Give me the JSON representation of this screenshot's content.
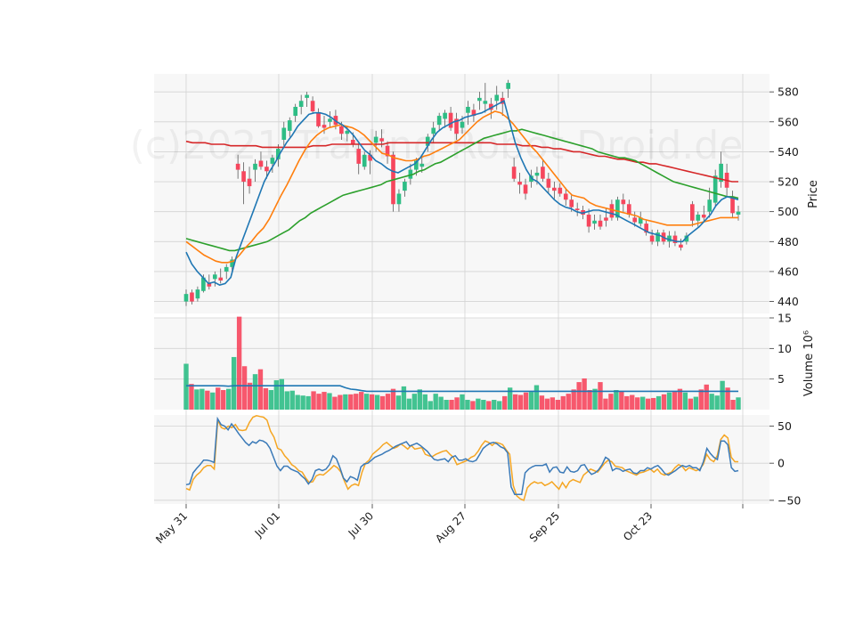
{
  "chart_data": {
    "type": "candlestick",
    "watermark": "(c)2021 Trading Robot Droid.de",
    "colors": {
      "up": "#2ebd85",
      "down": "#f6465d",
      "grid": "#d3d3d3",
      "panel_bg": "#f7f7f7",
      "ma1": "#1f77b4",
      "ma2": "#ff7f0e",
      "ma3": "#2ca02c",
      "ma4": "#d62728",
      "osc1": "#3b7ab8",
      "osc2": "#f5a623",
      "vol_ma": "#1f77b4"
    },
    "x_ticks": [
      "May 31",
      "Jul 01",
      "Jul 30",
      "Aug 27",
      "Sep 25",
      "Oct 23"
    ],
    "price_panel": {
      "ylabel": "Price",
      "ylim": [
        432,
        592
      ],
      "yticks": [
        440,
        460,
        480,
        500,
        520,
        540,
        560,
        580
      ]
    },
    "volume_panel": {
      "ylabel": "Volume  10⁶",
      "ylim": [
        0,
        15
      ],
      "yticks": [
        5,
        10,
        15
      ]
    },
    "osc_panel": {
      "ylim": [
        -55,
        65
      ],
      "yticks": [
        50,
        0,
        -50
      ]
    },
    "ohlc": [
      [
        440,
        448,
        437,
        445
      ],
      [
        446,
        448,
        438,
        440
      ],
      [
        442,
        450,
        440,
        448
      ],
      [
        447,
        458,
        446,
        456
      ],
      [
        452,
        458,
        448,
        450
      ],
      [
        455,
        460,
        450,
        458
      ],
      [
        456,
        462,
        452,
        454
      ],
      [
        460,
        465,
        455,
        463
      ],
      [
        463,
        470,
        458,
        468
      ],
      [
        532,
        538,
        522,
        528
      ],
      [
        527,
        533,
        505,
        520
      ],
      [
        522,
        530,
        512,
        517
      ],
      [
        528,
        535,
        520,
        532
      ],
      [
        534,
        540,
        528,
        530
      ],
      [
        530,
        534,
        522,
        527
      ],
      [
        532,
        538,
        526,
        536
      ],
      [
        535,
        545,
        530,
        542
      ],
      [
        548,
        560,
        544,
        556
      ],
      [
        554,
        563,
        550,
        561
      ],
      [
        564,
        572,
        560,
        570
      ],
      [
        570,
        578,
        565,
        574
      ],
      [
        576,
        580,
        570,
        578
      ],
      [
        574,
        577,
        566,
        567
      ],
      [
        566,
        569,
        556,
        557
      ],
      [
        558,
        564,
        552,
        556
      ],
      [
        560,
        567,
        556,
        562
      ],
      [
        564,
        568,
        555,
        558
      ],
      [
        557,
        560,
        548,
        552
      ],
      [
        552,
        557,
        547,
        554
      ],
      [
        548,
        553,
        543,
        545
      ],
      [
        542,
        546,
        525,
        532
      ],
      [
        530,
        540,
        528,
        538
      ],
      [
        538,
        541,
        525,
        534
      ],
      [
        546,
        554,
        540,
        550
      ],
      [
        549,
        555,
        543,
        547
      ],
      [
        544,
        547,
        532,
        537
      ],
      [
        538,
        540,
        500,
        505
      ],
      [
        505,
        515,
        500,
        512
      ],
      [
        514,
        522,
        510,
        520
      ],
      [
        522,
        532,
        518,
        528
      ],
      [
        528,
        536,
        524,
        534
      ],
      [
        530,
        536,
        526,
        532
      ],
      [
        544,
        552,
        540,
        550
      ],
      [
        552,
        560,
        546,
        556
      ],
      [
        558,
        566,
        554,
        564
      ],
      [
        562,
        568,
        556,
        566
      ],
      [
        566,
        570,
        554,
        556
      ],
      [
        562,
        566,
        548,
        552
      ],
      [
        556,
        564,
        552,
        560
      ],
      [
        566,
        574,
        558,
        570
      ],
      [
        568,
        572,
        560,
        564
      ],
      [
        574,
        580,
        568,
        576
      ],
      [
        572,
        586,
        566,
        574
      ],
      [
        572,
        576,
        562,
        568
      ],
      [
        574,
        584,
        568,
        578
      ],
      [
        576,
        580,
        564,
        572
      ],
      [
        582,
        588,
        576,
        586
      ],
      [
        530,
        536,
        520,
        522
      ],
      [
        520,
        526,
        512,
        518
      ],
      [
        518,
        522,
        508,
        512
      ],
      [
        520,
        528,
        516,
        524
      ],
      [
        524,
        530,
        518,
        526
      ],
      [
        530,
        534,
        520,
        522
      ],
      [
        522,
        526,
        512,
        516
      ],
      [
        516,
        520,
        508,
        514
      ],
      [
        516,
        519,
        510,
        512
      ],
      [
        512,
        516,
        504,
        508
      ],
      [
        508,
        512,
        500,
        503
      ],
      [
        502,
        506,
        497,
        501
      ],
      [
        501,
        504,
        495,
        498
      ],
      [
        498,
        502,
        486,
        490
      ],
      [
        492,
        498,
        488,
        494
      ],
      [
        494,
        498,
        488,
        490
      ],
      [
        496,
        502,
        490,
        494
      ],
      [
        505,
        508,
        494,
        496
      ],
      [
        496,
        510,
        494,
        508
      ],
      [
        508,
        512,
        500,
        505
      ],
      [
        505,
        508,
        496,
        498
      ],
      [
        496,
        500,
        490,
        493
      ],
      [
        492,
        500,
        490,
        496
      ],
      [
        492,
        494,
        484,
        486
      ],
      [
        484,
        488,
        478,
        480
      ],
      [
        480,
        488,
        477,
        486
      ],
      [
        486,
        488,
        478,
        480
      ],
      [
        480,
        487,
        476,
        484
      ],
      [
        484,
        487,
        477,
        479
      ],
      [
        478,
        482,
        474,
        476
      ],
      [
        480,
        486,
        478,
        484
      ],
      [
        505,
        507,
        490,
        494
      ],
      [
        494,
        500,
        490,
        498
      ],
      [
        498,
        504,
        494,
        496
      ],
      [
        500,
        516,
        496,
        508
      ],
      [
        506,
        528,
        504,
        524
      ],
      [
        520,
        540,
        516,
        532
      ],
      [
        526,
        532,
        510,
        516
      ],
      [
        510,
        514,
        496,
        499
      ],
      [
        498,
        504,
        494,
        500
      ]
    ],
    "volume": [
      7.5,
      4.2,
      3.3,
      3.4,
      3.1,
      2.8,
      3.6,
      3.2,
      3.4,
      8.6,
      15.2,
      7.1,
      4.4,
      5.8,
      6.6,
      3.5,
      3.2,
      4.8,
      5.0,
      3.0,
      3.1,
      2.4,
      2.3,
      2.2,
      3.0,
      2.6,
      2.9,
      2.7,
      2.1,
      2.4,
      2.5,
      2.5,
      2.6,
      2.9,
      2.6,
      2.5,
      2.4,
      2.2,
      2.6,
      3.4,
      2.3,
      3.8,
      1.8,
      2.6,
      3.3,
      2.5,
      1.4,
      2.6,
      2.1,
      1.6,
      1.6,
      2.0,
      2.5,
      1.6,
      1.4,
      1.8,
      1.6,
      1.4,
      1.6,
      1.4,
      2.2,
      3.6,
      2.5,
      2.4,
      2.8,
      2.9,
      4.0,
      2.3,
      1.8,
      2.0,
      1.6,
      2.2,
      2.6,
      3.3,
      4.5,
      5.1,
      3.2,
      3.4,
      4.5,
      1.8,
      2.6,
      3.2,
      3.0,
      2.2,
      2.4,
      2.0,
      2.1,
      1.8,
      1.9,
      2.2,
      2.5,
      2.8,
      2.9,
      3.4,
      2.8,
      1.8,
      2.1,
      3.3,
      4.1,
      2.6,
      2.3,
      4.7,
      3.6,
      1.6,
      2.0
    ],
    "osc_blue": [
      -29,
      -28,
      -13,
      -7,
      -2,
      4,
      4,
      3,
      1,
      60,
      52,
      50,
      45,
      53,
      47,
      40,
      34,
      28,
      24,
      29,
      27,
      31,
      30,
      27,
      20,
      8,
      -4,
      -10,
      -4,
      -4,
      -8,
      -10,
      -12,
      -17,
      -21,
      -28,
      -22,
      -10,
      -8,
      -10,
      -8,
      -2,
      10,
      6,
      -6,
      -20,
      -25,
      -18,
      -20,
      -23,
      -5,
      -1,
      0,
      4,
      8,
      10,
      12,
      15,
      17,
      20,
      23,
      25,
      27,
      29,
      23,
      25,
      27,
      24,
      20,
      16,
      10,
      5,
      4,
      5,
      6,
      2,
      8,
      10,
      4,
      4,
      6,
      3,
      2,
      4,
      12,
      20,
      24,
      27,
      28,
      26,
      22,
      20,
      14,
      -32,
      -42,
      -42,
      -42,
      -13,
      -8,
      -5,
      -3,
      -3,
      -3,
      -1,
      -12,
      -6,
      -5,
      -12,
      -13,
      -5,
      -11,
      -12,
      -10,
      -3,
      -2,
      -10,
      -15,
      -13,
      -9,
      -2,
      8,
      5,
      -10,
      -7,
      -8,
      -11,
      -9,
      -8,
      -13,
      -14,
      -10,
      -10,
      -6,
      -8,
      -5,
      -3,
      -8,
      -14,
      -16,
      -13,
      -10,
      -6,
      -3,
      -5,
      -3,
      -6,
      -6,
      -10,
      2,
      20,
      13,
      8,
      5,
      30,
      30,
      25,
      -6,
      -11,
      -10
    ],
    "osc_orange": [
      -34,
      -36,
      -22,
      -16,
      -12,
      -6,
      -3,
      -3,
      -8,
      58,
      48,
      46,
      50,
      48,
      52,
      45,
      44,
      45,
      55,
      62,
      64,
      63,
      62,
      58,
      43,
      35,
      20,
      18,
      10,
      5,
      -2,
      -5,
      -10,
      -12,
      -20,
      -26,
      -25,
      -17,
      -15,
      -16,
      -12,
      -8,
      -3,
      -6,
      -12,
      -24,
      -35,
      -30,
      -28,
      -30,
      -12,
      0,
      4,
      12,
      16,
      20,
      25,
      28,
      24,
      20,
      22,
      26,
      23,
      19,
      24,
      19,
      20,
      21,
      12,
      10,
      9,
      12,
      14,
      16,
      17,
      12,
      8,
      -2,
      0,
      2,
      4,
      8,
      10,
      16,
      24,
      30,
      28,
      24,
      28,
      27,
      25,
      18,
      12,
      -30,
      -44,
      -48,
      -50,
      -33,
      -28,
      -25,
      -27,
      -26,
      -30,
      -28,
      -25,
      -30,
      -35,
      -26,
      -33,
      -25,
      -22,
      -24,
      -26,
      -16,
      -12,
      -8,
      -10,
      -12,
      -6,
      0,
      4,
      2,
      -4,
      -5,
      -6,
      -10,
      -12,
      -14,
      -16,
      -13,
      -12,
      -10,
      -8,
      -12,
      -8,
      -14,
      -16,
      -14,
      -12,
      -6,
      -2,
      -4,
      -10,
      -6,
      -8,
      -10,
      -8,
      -2,
      12,
      5,
      2,
      10,
      32,
      38,
      34,
      8,
      2,
      2
    ],
    "ma_blue": [
      473,
      465,
      460,
      456,
      452,
      453,
      451,
      452,
      456,
      470,
      480,
      490,
      500,
      510,
      520,
      527,
      533,
      540,
      546,
      551,
      557,
      561,
      565,
      566,
      566,
      565,
      563,
      560,
      558,
      555,
      551,
      546,
      541,
      538,
      534,
      532,
      529,
      527,
      526,
      528,
      530,
      532,
      536,
      542,
      548,
      553,
      556,
      558,
      560,
      561,
      563,
      564,
      565,
      566,
      568,
      570,
      572,
      574,
      560,
      546,
      536,
      528,
      522,
      520,
      516,
      512,
      508,
      505,
      503,
      502,
      500,
      499,
      500,
      501,
      501,
      500,
      499,
      498,
      496,
      494,
      492,
      490,
      488,
      486,
      485,
      484,
      482,
      481,
      480,
      480,
      484,
      487,
      490,
      494,
      498,
      504,
      508,
      510,
      509,
      508
    ],
    "ma_orange": [
      480,
      477,
      474,
      471,
      469,
      467,
      466,
      466,
      467,
      471,
      476,
      480,
      485,
      489,
      495,
      503,
      511,
      518,
      526,
      534,
      541,
      547,
      551,
      554,
      556,
      557,
      558,
      557,
      556,
      554,
      551,
      547,
      543,
      539,
      538,
      536,
      535,
      534,
      534,
      535,
      537,
      538,
      540,
      542,
      544,
      546,
      548,
      552,
      556,
      560,
      563,
      565,
      567,
      566,
      563,
      559,
      554,
      549,
      544,
      540,
      535,
      530,
      525,
      520,
      515,
      511,
      510,
      509,
      506,
      504,
      503,
      502,
      501,
      500,
      499,
      498,
      497,
      495,
      494,
      493,
      492,
      491,
      491,
      491,
      491,
      491,
      492,
      493,
      494,
      495,
      496,
      496,
      496,
      496
    ],
    "ma_green": [
      482,
      481,
      480,
      479,
      478,
      477,
      476,
      475,
      474,
      474,
      475,
      476,
      477,
      478,
      479,
      480,
      482,
      484,
      486,
      488,
      491,
      494,
      496,
      499,
      501,
      503,
      505,
      507,
      509,
      511,
      512,
      513,
      514,
      515,
      516,
      517,
      518,
      520,
      521,
      522,
      523,
      524,
      525,
      527,
      528,
      530,
      532,
      533,
      535,
      537,
      539,
      541,
      543,
      545,
      547,
      549,
      550,
      551,
      552,
      553,
      554,
      554,
      555,
      554,
      553,
      552,
      551,
      550,
      549,
      548,
      547,
      546,
      545,
      544,
      543,
      542,
      540,
      539,
      538,
      537,
      536,
      536,
      535,
      534,
      532,
      530,
      528,
      526,
      524,
      522,
      520,
      519,
      518,
      517,
      516,
      515,
      514,
      513,
      512,
      511,
      510,
      510,
      509
    ],
    "ma_red": [
      547,
      546,
      546,
      546,
      545,
      545,
      545,
      544,
      544,
      544,
      544,
      544,
      543,
      543,
      543,
      543,
      543,
      543,
      543,
      543,
      544,
      544,
      544,
      545,
      545,
      545,
      545,
      545,
      545,
      545,
      545,
      545,
      546,
      546,
      546,
      546,
      546,
      546,
      546,
      546,
      546,
      546,
      546,
      546,
      546,
      546,
      546,
      546,
      546,
      545,
      545,
      545,
      545,
      544,
      544,
      544,
      543,
      543,
      542,
      542,
      541,
      540,
      540,
      539,
      538,
      537,
      537,
      536,
      535,
      535,
      534,
      533,
      533,
      532,
      532,
      531,
      530,
      529,
      528,
      527,
      526,
      525,
      524,
      523,
      522,
      521,
      520,
      520
    ]
  }
}
